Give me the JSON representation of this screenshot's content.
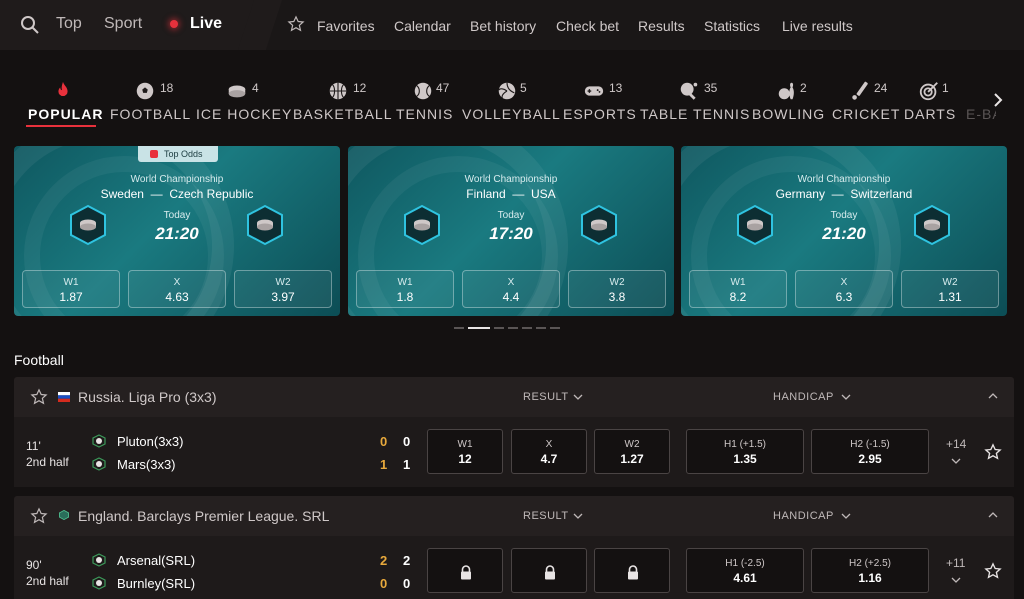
{
  "topnav": {
    "left": [
      {
        "label": "Top"
      },
      {
        "label": "Sport"
      },
      {
        "label": "Live"
      }
    ],
    "right": [
      "Favorites",
      "Calendar",
      "Bet history",
      "Check bet",
      "Results",
      "Statistics",
      "Live results"
    ]
  },
  "sports": [
    {
      "label": "POPULAR",
      "count": "",
      "icon": "flame-icon",
      "active": true
    },
    {
      "label": "FOOTBALL",
      "count": "18",
      "icon": "football-icon"
    },
    {
      "label": "ICE HOCKEY",
      "count": "4",
      "icon": "hockey-puck-icon"
    },
    {
      "label": "BASKETBALL",
      "count": "12",
      "icon": "basketball-icon"
    },
    {
      "label": "TENNIS",
      "count": "47",
      "icon": "tennis-ball-icon"
    },
    {
      "label": "VOLLEYBALL",
      "count": "5",
      "icon": "volleyball-icon"
    },
    {
      "label": "ESPORTS",
      "count": "13",
      "icon": "gamepad-icon"
    },
    {
      "label": "TABLE TENNIS",
      "count": "35",
      "icon": "table-tennis-icon"
    },
    {
      "label": "BOWLING",
      "count": "2",
      "icon": "bowling-icon"
    },
    {
      "label": "CRICKET",
      "count": "24",
      "icon": "cricket-icon"
    },
    {
      "label": "DARTS",
      "count": "1",
      "icon": "darts-icon"
    },
    {
      "label": "E-BAS",
      "count": "",
      "icon": ""
    }
  ],
  "top_odds_badge": "Top Odds",
  "cards": [
    {
      "league": "World Championship",
      "home": "Sweden",
      "away": "Czech Republic",
      "day": "Today",
      "time": "21:20",
      "odds": [
        {
          "label": "W1",
          "value": "1.87"
        },
        {
          "label": "X",
          "value": "4.63"
        },
        {
          "label": "W2",
          "value": "3.97"
        }
      ]
    },
    {
      "league": "World Championship",
      "home": "Finland",
      "away": "USA",
      "day": "Today",
      "time": "17:20",
      "odds": [
        {
          "label": "W1",
          "value": "1.8"
        },
        {
          "label": "X",
          "value": "4.4"
        },
        {
          "label": "W2",
          "value": "3.8"
        }
      ]
    },
    {
      "league": "World Championship",
      "home": "Germany",
      "away": "Switzerland",
      "day": "Today",
      "time": "21:20",
      "odds": [
        {
          "label": "W1",
          "value": "8.2"
        },
        {
          "label": "X",
          "value": "6.3"
        },
        {
          "label": "W2",
          "value": "1.31"
        }
      ]
    }
  ],
  "carousel": {
    "count": 7,
    "active_index": 1
  },
  "section_title": "Football",
  "leagues": [
    {
      "name": "Russia. Liga Pro (3x3)",
      "result_label": "RESULT",
      "handicap_label": "HANDICAP",
      "match": {
        "minute": "11'",
        "half": "2nd half",
        "home": "Pluton(3x3)",
        "away": "Mars(3x3)",
        "home_scores": [
          "0",
          "0"
        ],
        "away_scores": [
          "1",
          "1"
        ],
        "result": [
          {
            "label": "W1",
            "value": "12"
          },
          {
            "label": "X",
            "value": "4.7"
          },
          {
            "label": "W2",
            "value": "1.27"
          }
        ],
        "handicap": [
          {
            "label": "H1 (+1.5)",
            "value": "1.35"
          },
          {
            "label": "H2 (-1.5)",
            "value": "2.95"
          }
        ],
        "more": "+14"
      }
    },
    {
      "name": "England. Barclays Premier League. SRL",
      "result_label": "RESULT",
      "handicap_label": "HANDICAP",
      "match": {
        "minute": "90'",
        "half": "2nd half",
        "home": "Arsenal(SRL)",
        "away": "Burnley(SRL)",
        "home_scores": [
          "2",
          "2"
        ],
        "away_scores": [
          "0",
          "0"
        ],
        "result": [
          {
            "label": "",
            "value": ""
          },
          {
            "label": "",
            "value": ""
          },
          {
            "label": "",
            "value": ""
          }
        ],
        "handicap": [
          {
            "label": "H1 (-2.5)",
            "value": "4.61"
          },
          {
            "label": "H2 (+2.5)",
            "value": "1.16"
          }
        ],
        "more": "+11"
      }
    }
  ],
  "colors": {
    "accent": "#e8313c",
    "card": "#1a7a80",
    "score_lead": "#e8a93c"
  }
}
